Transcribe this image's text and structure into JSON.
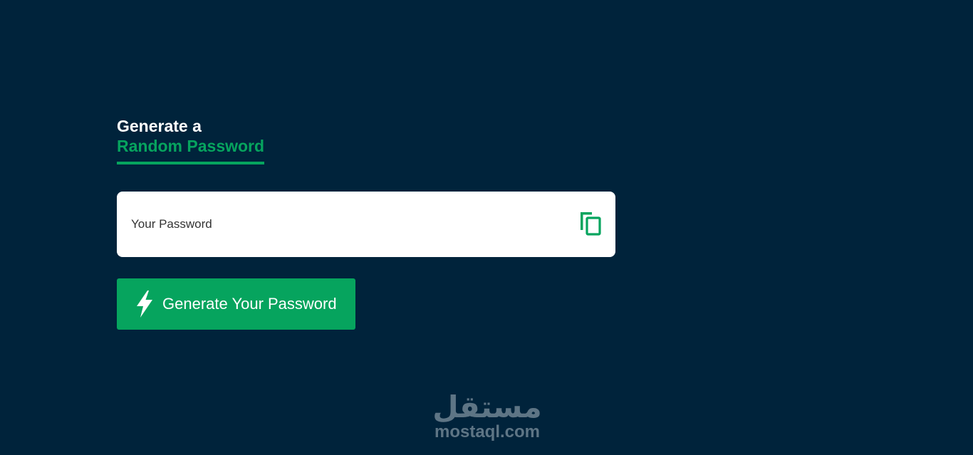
{
  "heading": {
    "line1": "Generate a",
    "line2": "Random Password"
  },
  "password_field": {
    "placeholder": "Your Password",
    "value": ""
  },
  "copy_button": {
    "icon": "copy-icon"
  },
  "generate_button": {
    "label": "Generate Your Password",
    "icon": "lightning-bolt-icon"
  },
  "watermark": {
    "arabic": "مستقل",
    "latin": "mostaql.com"
  },
  "colors": {
    "background": "#00233b",
    "accent": "#06a45e",
    "field_bg": "#ffffff",
    "watermark": "#5e7585"
  }
}
